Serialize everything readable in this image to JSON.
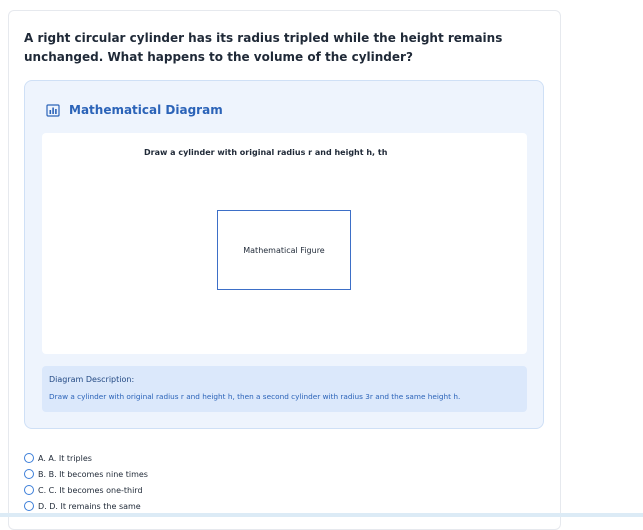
{
  "question": "A right circular cylinder has its radius tripled while the height remains unchanged. What happens to the volume of the cylinder?",
  "diagram": {
    "header_icon": "bar-chart-icon",
    "title": "Mathematical Diagram",
    "caption": "Draw a cylinder with original radius r and height h, th",
    "figure_label": "Mathematical Figure",
    "description_label": "Diagram Description:",
    "description_text": "Draw a cylinder with original radius r and height h, then a second cylinder with radius 3r and the same height h."
  },
  "options": [
    {
      "label": "A. A. It triples"
    },
    {
      "label": "B. B. It becomes nine times"
    },
    {
      "label": "C. C. It becomes one-third"
    },
    {
      "label": "D. D. It remains the same"
    }
  ],
  "colors": {
    "accent": "#2b63b8",
    "panel_bg": "#eef4fd",
    "description_bg": "#dbe8fb",
    "radio_border": "#3d7fd9"
  }
}
